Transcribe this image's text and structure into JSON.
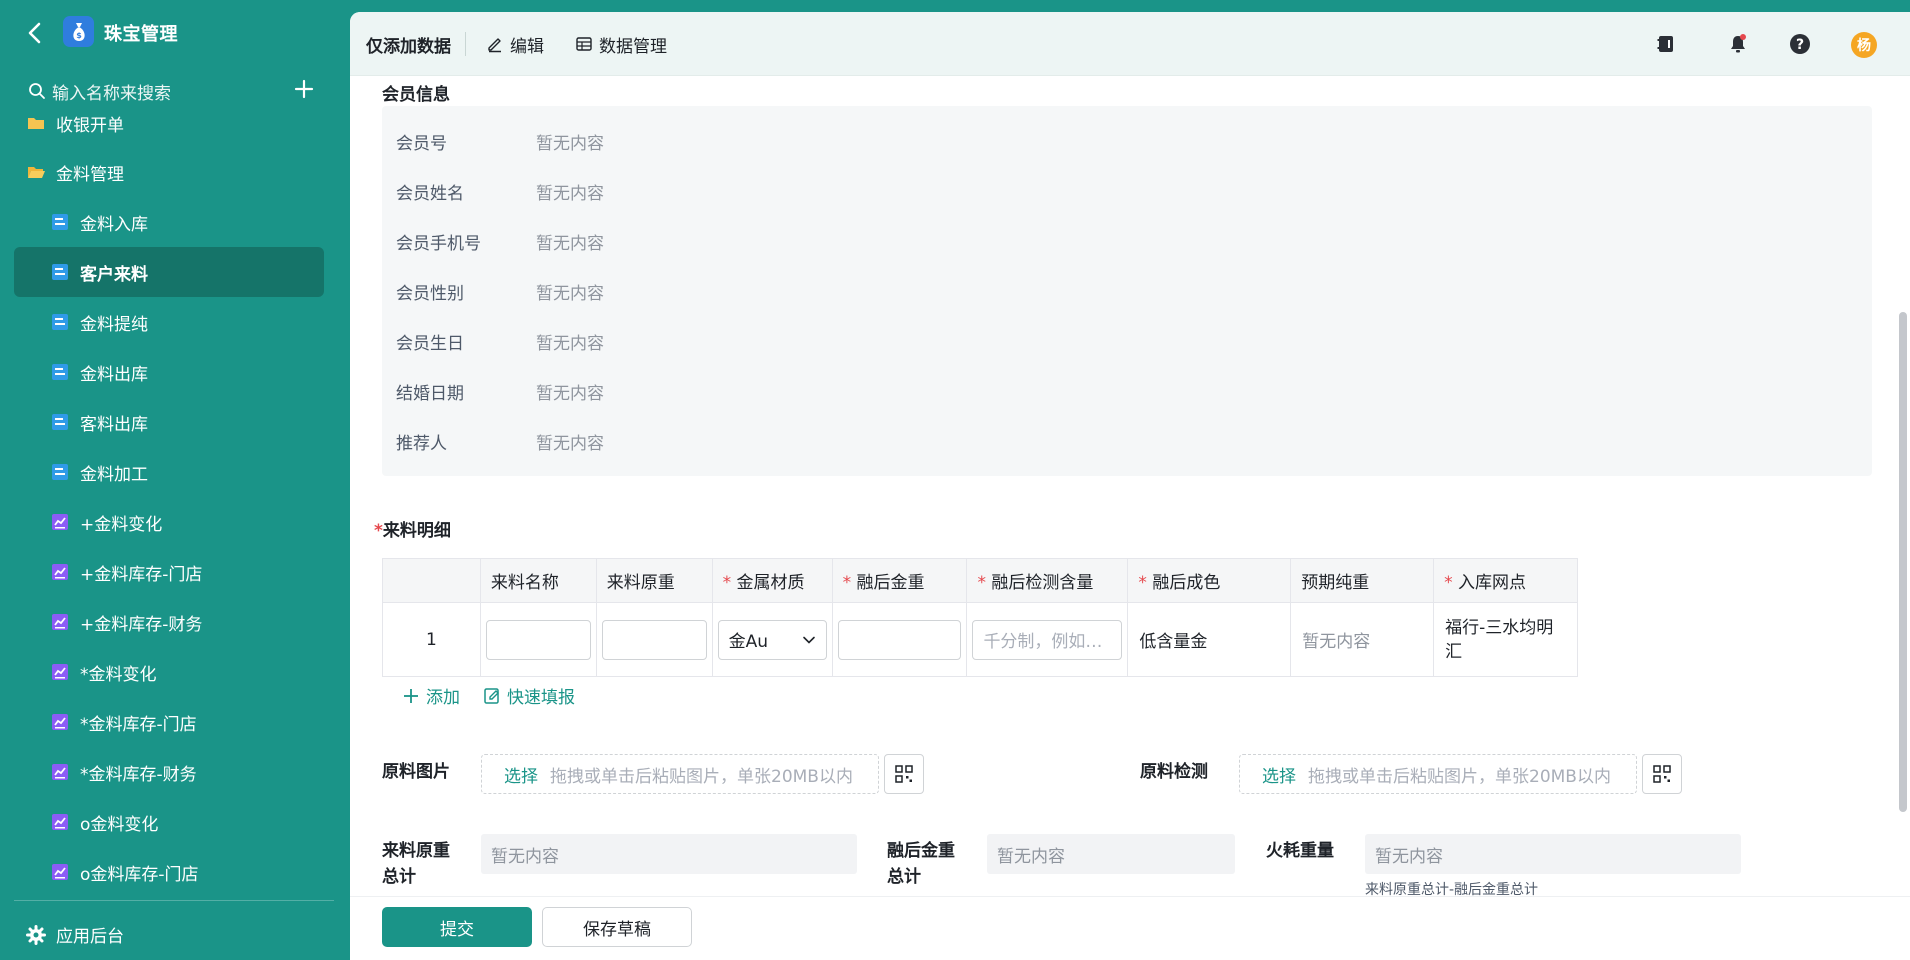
{
  "app": {
    "title": "珠宝管理"
  },
  "sidebar": {
    "search_placeholder": "输入名称来搜索",
    "partial_item": "收银开单",
    "items": [
      {
        "label": "金料管理",
        "icon": "folder-icon",
        "level": 1,
        "active": false
      },
      {
        "label": "金料入库",
        "icon": "form-icon",
        "level": 2,
        "active": false
      },
      {
        "label": "客户来料",
        "icon": "form-icon",
        "level": 2,
        "active": true
      },
      {
        "label": "金料提纯",
        "icon": "form-icon",
        "level": 2,
        "active": false
      },
      {
        "label": "金料出库",
        "icon": "form-icon",
        "level": 2,
        "active": false
      },
      {
        "label": "客料出库",
        "icon": "form-icon",
        "level": 2,
        "active": false
      },
      {
        "label": "金料加工",
        "icon": "form-icon",
        "level": 2,
        "active": false
      },
      {
        "label": "+金料变化",
        "icon": "report-icon",
        "level": 2,
        "active": false
      },
      {
        "label": "+金料库存-门店",
        "icon": "report-icon",
        "level": 2,
        "active": false
      },
      {
        "label": "+金料库存-财务",
        "icon": "report-icon",
        "level": 2,
        "active": false
      },
      {
        "label": "*金料变化",
        "icon": "report-icon",
        "level": 2,
        "active": false
      },
      {
        "label": "*金料库存-门店",
        "icon": "report-icon",
        "level": 2,
        "active": false
      },
      {
        "label": "*金料库存-财务",
        "icon": "report-icon",
        "level": 2,
        "active": false
      },
      {
        "label": "o金料变化",
        "icon": "report-icon",
        "level": 2,
        "active": false
      },
      {
        "label": "o金料库存-门店",
        "icon": "report-icon",
        "level": 2,
        "active": false
      }
    ],
    "footer_label": "应用后台"
  },
  "topbar": {
    "title": "仅添加数据",
    "edit_label": "编辑",
    "data_mgmt_label": "数据管理",
    "avatar_text": "杨"
  },
  "member_section": {
    "title": "会员信息",
    "rows": [
      {
        "label": "会员号",
        "value": "暂无内容"
      },
      {
        "label": "会员姓名",
        "value": "暂无内容"
      },
      {
        "label": "会员手机号",
        "value": "暂无内容"
      },
      {
        "label": "会员性别",
        "value": "暂无内容"
      },
      {
        "label": "会员生日",
        "value": "暂无内容"
      },
      {
        "label": "结婚日期",
        "value": "暂无内容"
      },
      {
        "label": "推荐人",
        "value": "暂无内容"
      }
    ]
  },
  "detail_section": {
    "title": "来料明细",
    "required_mark": "*",
    "columns": [
      {
        "label": "",
        "required": false
      },
      {
        "label": "来料名称",
        "required": false
      },
      {
        "label": "来料原重",
        "required": false
      },
      {
        "label": "金属材质",
        "required": true
      },
      {
        "label": "融后金重",
        "required": true
      },
      {
        "label": "融后检测含量",
        "required": true
      },
      {
        "label": "融后成色",
        "required": true
      },
      {
        "label": "预期纯重",
        "required": false
      },
      {
        "label": "入库网点",
        "required": true
      }
    ],
    "row": {
      "index": "1",
      "name": "",
      "raw_weight": "",
      "material": "金Au",
      "melt_weight": "",
      "content_placeholder": "千分制，例如…",
      "fineness": "低含量金",
      "expected_pure": "暂无内容",
      "store": "福行-三水均明汇"
    },
    "add_label": "添加",
    "quick_fill_label": "快速填报"
  },
  "uploads": {
    "raw_image_label": "原料图片",
    "raw_test_label": "原料检测",
    "pick_label": "选择",
    "hint": "拖拽或单击后粘贴图片，单张20MB以内"
  },
  "totals": {
    "raw_total_label": "来料原重总计",
    "raw_total_value": "暂无内容",
    "melt_total_label": "融后金重总计",
    "melt_total_value": "暂无内容",
    "loss_label": "火耗重量",
    "loss_value": "暂无内容",
    "loss_formula": "来料原重总计-融后金重总计"
  },
  "footer": {
    "submit_label": "提交",
    "draft_label": "保存草稿"
  },
  "colors": {
    "brand": "#1a9488",
    "active_nav": "#157469",
    "required": "#e5484d",
    "avatar": "#f5a623"
  }
}
